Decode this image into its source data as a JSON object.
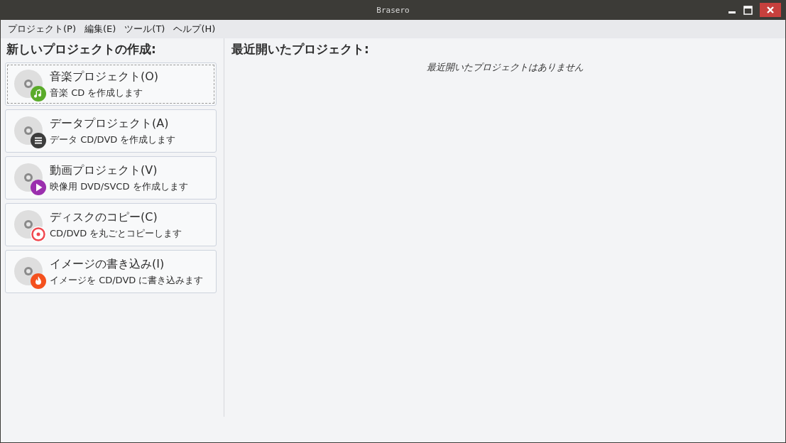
{
  "window": {
    "title": "Brasero"
  },
  "menu": [
    "プロジェクト(P)",
    "編集(E)",
    "ツール(T)",
    "ヘルプ(H)"
  ],
  "new_project": {
    "heading": "新しいプロジェクトの作成:",
    "items": [
      {
        "kind": "music",
        "title": "音楽プロジェクト(O)",
        "subtitle": "音楽 CD を作成します",
        "selected": true
      },
      {
        "kind": "data",
        "title": "データプロジェクト(A)",
        "subtitle": "データ CD/DVD を作成します",
        "selected": false
      },
      {
        "kind": "video",
        "title": "動画プロジェクト(V)",
        "subtitle": "映像用 DVD/SVCD を作成します",
        "selected": false
      },
      {
        "kind": "copy",
        "title": "ディスクのコピー(C)",
        "subtitle": "CD/DVD を丸ごとコピーします",
        "selected": false
      },
      {
        "kind": "image",
        "title": "イメージの書き込み(I)",
        "subtitle": "イメージを CD/DVD に書き込みます",
        "selected": false
      }
    ]
  },
  "recent": {
    "heading": "最近開いたプロジェクト:",
    "empty_message": "最近開いたプロジェクトはありません"
  }
}
